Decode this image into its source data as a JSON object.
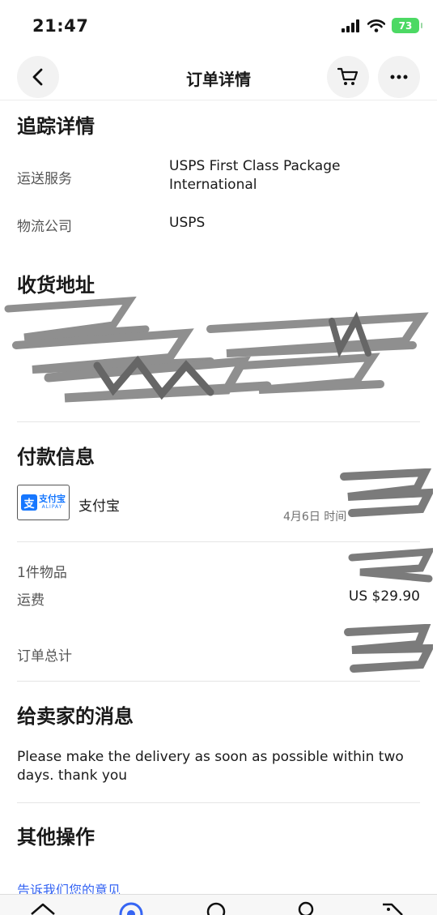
{
  "status_bar": {
    "time": "21:47",
    "battery": "73"
  },
  "nav": {
    "title": "订单详情",
    "back_icon": "chevron-left-icon",
    "cart_icon": "cart-icon",
    "more_icon": "more-horizontal-icon"
  },
  "tracking": {
    "title": "追踪详情",
    "service_label": "运送服务",
    "service_value": "USPS First Class Package International",
    "carrier_label": "物流公司",
    "carrier_value": "USPS"
  },
  "address": {
    "title": "收货地址"
  },
  "payment": {
    "title": "付款信息",
    "method_logo_cn": "支付宝",
    "method_logo_en": "ALIPAY",
    "method_logo_mark": "支",
    "method_name": "支付宝",
    "date_partial": "4月6日 时间"
  },
  "summary": {
    "items_label": "1件物品",
    "shipping_label": "运费",
    "shipping_value": "US $29.90",
    "total_label": "订单总计"
  },
  "seller_message": {
    "title": "给卖家的消息",
    "text": "Please make the delivery as soon as possible within two days. thank you"
  },
  "other_actions": {
    "title": "其他操作",
    "feedback_link": "告诉我们您的意见"
  },
  "bottom_tabs": [
    "home-icon",
    "my-ebay-icon",
    "search-icon",
    "user-icon",
    "selling-icon"
  ]
}
